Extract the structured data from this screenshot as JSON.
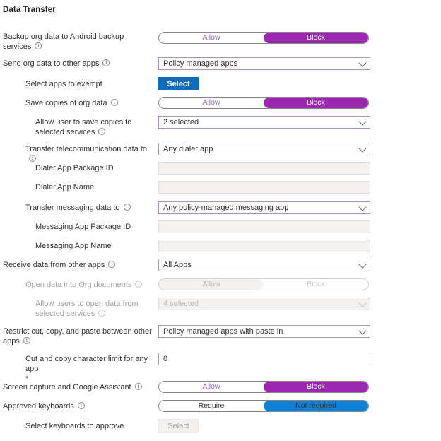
{
  "section": {
    "title": "Data Transfer"
  },
  "rows": [
    {
      "label": "Backup org data to Android backup services",
      "control": "toggle",
      "options": [
        "Allow",
        "Block"
      ],
      "value": "Block"
    },
    {
      "label": "Send org data to other apps",
      "control": "dropdown",
      "value": "Policy managed apps"
    },
    {
      "label": "Select apps to exempt",
      "control": "button",
      "value": "Select"
    },
    {
      "label": "Save copies of org data",
      "control": "toggle",
      "options": [
        "Allow",
        "Block"
      ],
      "value": "Block"
    },
    {
      "label": "Allow user to save copies to selected services",
      "control": "dropdown",
      "value": "2 selected"
    },
    {
      "label": "Transfer telecommunication data to",
      "control": "dropdown",
      "value": "Any dialer app"
    },
    {
      "label": "Dialer App Package ID",
      "control": "textbox",
      "value": ""
    },
    {
      "label": "Dialer App Name",
      "control": "textbox",
      "value": ""
    },
    {
      "label": "Transfer messaging data to",
      "control": "dropdown",
      "value": "Any policy-managed messaging app"
    },
    {
      "label": "Messaging App Package ID",
      "control": "textbox",
      "value": ""
    },
    {
      "label": "Messaging App Name",
      "control": "textbox",
      "value": ""
    },
    {
      "label": "Receive data from other apps",
      "control": "dropdown",
      "value": "All Apps"
    },
    {
      "label": "Open data into Org documents",
      "control": "toggle",
      "options": [
        "Allow",
        "Block"
      ],
      "value": "Allow"
    },
    {
      "label": "Allow users to open data from selected services",
      "control": "dropdown",
      "value": "4 selected"
    },
    {
      "label": "Restrict cut, copy, and paste between other apps",
      "control": "dropdown",
      "value": "Policy managed apps with paste in"
    },
    {
      "label": "Cut and copy character limit for any app",
      "control": "textbox",
      "value": "0",
      "required_marker": "*"
    },
    {
      "label": "Screen capture and Google Assistant",
      "control": "toggle",
      "options": [
        "Allow",
        "Block"
      ],
      "value": "Block"
    },
    {
      "label": "Approved keyboards",
      "control": "toggle",
      "options": [
        "Require",
        "Not required"
      ],
      "value": "Not required"
    },
    {
      "label": "Select keyboards to approve",
      "control": "button",
      "value": "Select"
    }
  ],
  "colors": {
    "accent_purple": "#9b26b0",
    "accent_blue": "#0f7fd4",
    "button_blue": "#0f6cbd",
    "required_red": "#a4262c",
    "modified_border": "#b48bc6"
  }
}
